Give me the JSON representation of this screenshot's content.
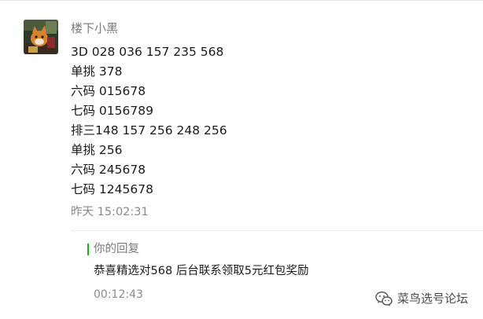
{
  "comment": {
    "nickname": "楼下小黑",
    "lines": [
      "3D 028 036 157 235 568",
      "单挑 378",
      "六码 015678",
      "七码 0156789",
      "排三148 157 256 248 256",
      "单挑 256",
      "六码 245678",
      "七码 1245678"
    ],
    "time": "昨天 15:02:31"
  },
  "reply": {
    "label": "你的回复",
    "text": "恭喜精选对568 后台联系领取5元红包奖励",
    "time": "00:12:43",
    "accent_color": "#1aad19"
  },
  "watermark": {
    "text": "菜鸟选号论坛",
    "icon": "wechat-icon"
  }
}
